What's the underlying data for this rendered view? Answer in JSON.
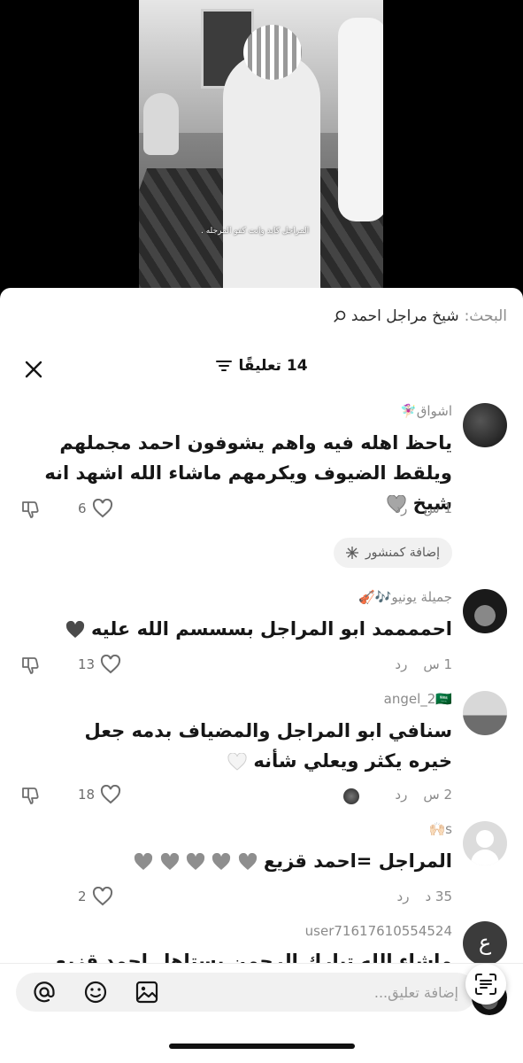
{
  "video": {
    "caption": "المراجل كابد وانت كفو المرجله ."
  },
  "search": {
    "prefix": "البحث:",
    "term": "شيخ مراجل احمد"
  },
  "comments_header": {
    "title": "14 تعليقًا"
  },
  "comments": [
    {
      "username": "اشواق🧚🏻‍♀️",
      "text": "ياحظ اهله فيه واهم يشوفون احمد مجملهم ويلقط الضيوف ويكرمهم ماشاء الله اشهد انه شيخ",
      "time": "1 س",
      "reply": "رد",
      "likes": "6"
    },
    {
      "username": "جميلة يونيو🎶🎻",
      "text": "احممممد ابو المراجل بسسسم الله عليه",
      "time": "1 س",
      "reply": "رد",
      "likes": "13"
    },
    {
      "username": "angel_2🇸🇦",
      "text": "سنافي ابو المراجل والمضياف بدمه جعل خيره يكثر ويعلي شأنه",
      "time": "2 س",
      "reply": "رد",
      "likes": "18"
    },
    {
      "username": "s🙌🏻",
      "text": "المراجل =احمد قزيع",
      "time": "35 د",
      "reply": "رد",
      "likes": "2"
    },
    {
      "username": "user71617610554524",
      "avatar_letter": "ع",
      "text": "ماشاء الله تبارك الرحمن يستاهل احمد قزيع السهلي"
    }
  ],
  "post_chip": {
    "label": "إضافة كمنشور"
  },
  "input": {
    "placeholder": "إضافة تعليق..."
  },
  "icons": {
    "close": "close-icon",
    "sort": "sort-icon",
    "heart": "heart-icon",
    "dislike": "dislike-icon",
    "mention": "at-icon",
    "emoji": "emoji-icon",
    "image": "image-icon",
    "scan": "scan-text-icon"
  }
}
